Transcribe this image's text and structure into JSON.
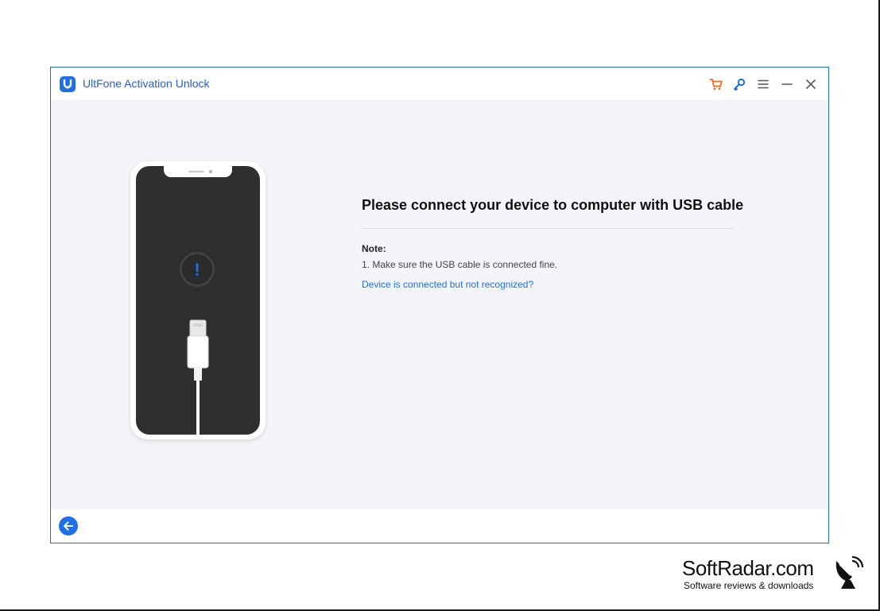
{
  "app": {
    "title": "UltFone Activation Unlock"
  },
  "titlebar": {
    "icons": [
      "cart-icon",
      "key-icon",
      "menu-icon",
      "minimize-icon",
      "close-icon"
    ]
  },
  "illustration": {
    "alert_symbol": "!"
  },
  "content": {
    "heading": "Please connect your device to computer with USB cable",
    "note_label": "Note:",
    "note_items": [
      "1. Make sure the USB cable is connected fine."
    ],
    "help_link": "Device is connected but not recognized?"
  },
  "footer": {
    "back_icon": "arrow-left-icon"
  },
  "watermark": {
    "name": "SoftRadar.com",
    "tagline": "Software reviews & downloads"
  },
  "colors": {
    "accent": "#1f6fe8",
    "cart": "#f26a21",
    "background": "#f4f5f9",
    "phone_screen": "#2f2f2f"
  }
}
